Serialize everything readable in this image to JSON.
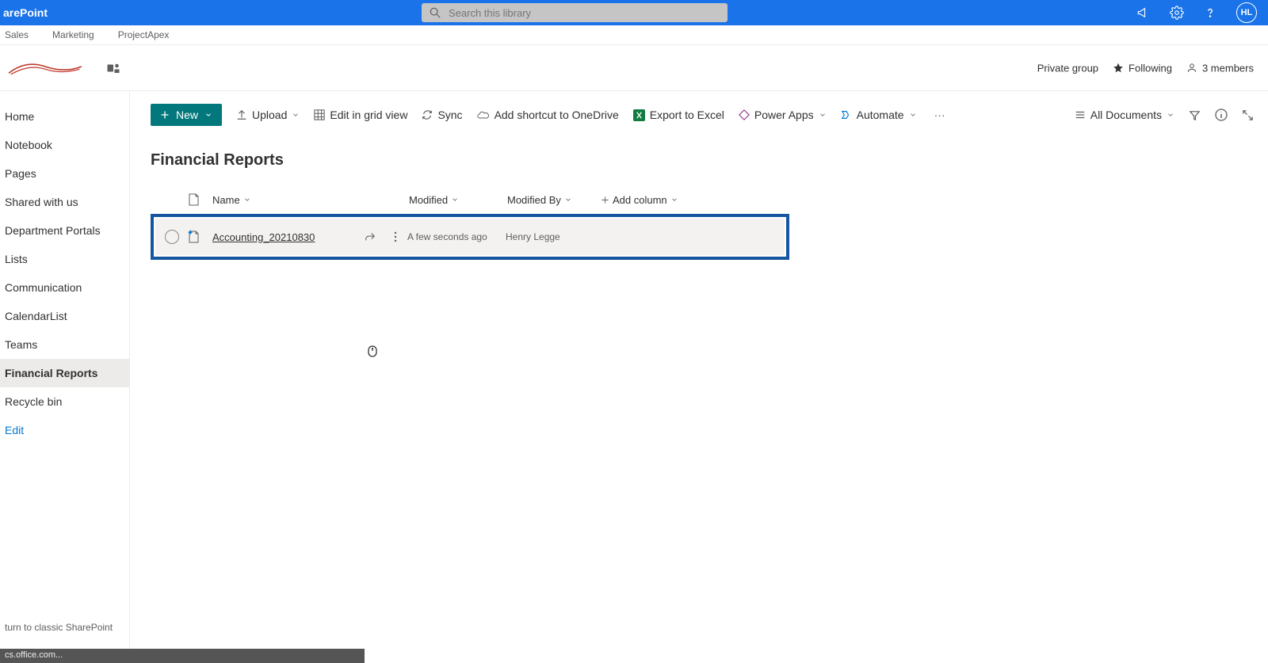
{
  "app_name": "arePoint",
  "search": {
    "placeholder": "Search this library"
  },
  "user_initials": "HL",
  "breadcrumbs": [
    "Sales",
    "Marketing",
    "ProjectApex"
  ],
  "site": {
    "privacy": "Private group",
    "following_label": "Following",
    "members_label": "3 members"
  },
  "sidebar": {
    "items": [
      {
        "label": "Home"
      },
      {
        "label": "Notebook"
      },
      {
        "label": "Pages"
      },
      {
        "label": "Shared with us"
      },
      {
        "label": "Department Portals"
      },
      {
        "label": "Lists"
      },
      {
        "label": "Communication"
      },
      {
        "label": "CalendarList"
      },
      {
        "label": "Teams"
      },
      {
        "label": "Financial Reports"
      },
      {
        "label": "Recycle bin"
      }
    ],
    "edit_label": "Edit",
    "classic_label": "turn to classic SharePoint"
  },
  "toolbar": {
    "new_label": "New",
    "upload_label": "Upload",
    "grid_label": "Edit in grid view",
    "sync_label": "Sync",
    "shortcut_label": "Add shortcut to OneDrive",
    "export_label": "Export to Excel",
    "powerapps_label": "Power Apps",
    "automate_label": "Automate",
    "view_label": "All Documents"
  },
  "library": {
    "title": "Financial Reports",
    "columns": {
      "name": "Name",
      "modified": "Modified",
      "modified_by": "Modified By",
      "add": "Add column"
    },
    "rows": [
      {
        "name": "Accounting_20210830",
        "modified": "A few seconds ago",
        "modified_by": "Henry Legge"
      }
    ]
  },
  "status_text": "cs.office.com..."
}
